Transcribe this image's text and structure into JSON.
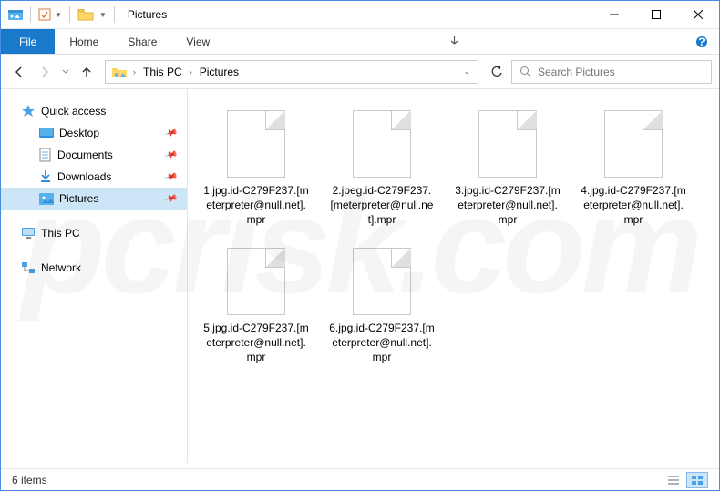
{
  "titlebar": {
    "title": "Pictures"
  },
  "ribbon": {
    "file": "File",
    "tabs": [
      "Home",
      "Share",
      "View"
    ]
  },
  "address": {
    "crumbs": [
      "This PC",
      "Pictures"
    ]
  },
  "search": {
    "placeholder": "Search Pictures"
  },
  "sidebar": {
    "quick_access": "Quick access",
    "items": [
      {
        "label": "Desktop",
        "pinned": true
      },
      {
        "label": "Documents",
        "pinned": true
      },
      {
        "label": "Downloads",
        "pinned": true
      },
      {
        "label": "Pictures",
        "pinned": true,
        "selected": true
      }
    ],
    "this_pc": "This PC",
    "network": "Network"
  },
  "files": [
    {
      "name": "1.jpg.id-C279F237.[meterpreter@null.net].mpr"
    },
    {
      "name": "2.jpeg.id-C279F237.[meterpreter@null.net].mpr"
    },
    {
      "name": "3.jpg.id-C279F237.[meterpreter@null.net].mpr"
    },
    {
      "name": "4.jpg.id-C279F237.[meterpreter@null.net].mpr"
    },
    {
      "name": "5.jpg.id-C279F237.[meterpreter@null.net].mpr"
    },
    {
      "name": "6.jpg.id-C279F237.[meterpreter@null.net].mpr"
    }
  ],
  "status": {
    "count": "6 items"
  },
  "watermark": "pcrisk.com"
}
